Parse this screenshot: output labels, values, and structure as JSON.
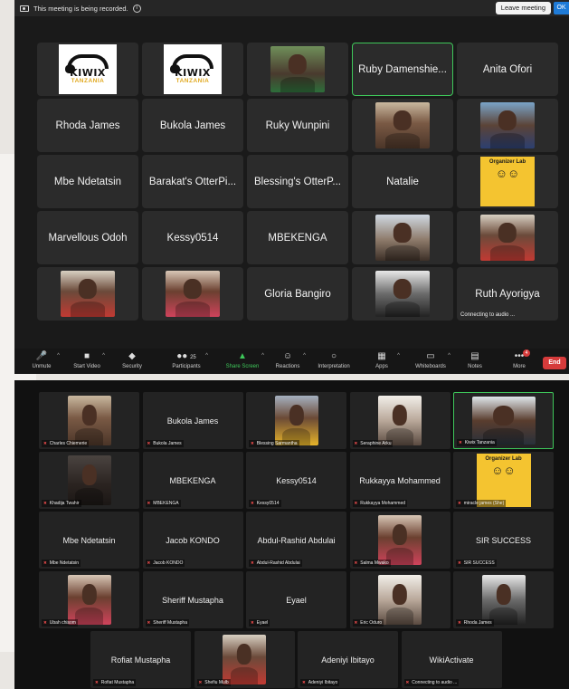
{
  "shot1": {
    "recording_notice": "This meeting is being recorded.",
    "leave_label": "Leave meeting",
    "ok_label": "OK",
    "tiles": [
      {
        "name": "",
        "kind": "kiwix"
      },
      {
        "name": "",
        "kind": "kiwix"
      },
      {
        "name": "",
        "kind": "photo",
        "tone": "ph-green"
      },
      {
        "name": "Ruby Damenshie...",
        "kind": "name",
        "active": true
      },
      {
        "name": "Anita Ofori",
        "kind": "name"
      },
      {
        "name": "Rhoda James",
        "kind": "name"
      },
      {
        "name": "Bukola James",
        "kind": "name"
      },
      {
        "name": "Ruky Wunpini",
        "kind": "name"
      },
      {
        "name": "",
        "kind": "photo",
        "tone": "ph-skin"
      },
      {
        "name": "",
        "kind": "photo",
        "tone": "ph-blue"
      },
      {
        "name": "Mbe Ndetatsin",
        "kind": "name"
      },
      {
        "name": "Barakat's OtterPi...",
        "kind": "name"
      },
      {
        "name": "Blessing's OtterP...",
        "kind": "name"
      },
      {
        "name": "Natalie",
        "kind": "name"
      },
      {
        "name": "",
        "kind": "orglab"
      },
      {
        "name": "Marvellous Odoh",
        "kind": "name"
      },
      {
        "name": "Kessy0514",
        "kind": "name"
      },
      {
        "name": "MBEKENGA",
        "kind": "name"
      },
      {
        "name": "",
        "kind": "photo",
        "tone": "ph-room"
      },
      {
        "name": "",
        "kind": "photo",
        "tone": "ph-red"
      },
      {
        "name": "",
        "kind": "photo",
        "tone": "ph-red"
      },
      {
        "name": "",
        "kind": "photo",
        "tone": "ph-pink"
      },
      {
        "name": "Gloria Bangiro",
        "kind": "name"
      },
      {
        "name": "",
        "kind": "photo",
        "tone": "ph-gray"
      },
      {
        "name": "Ruth Ayorigya",
        "kind": "name",
        "sub": "Connecting to audio ..."
      }
    ],
    "toolbar": {
      "unmute": "Unmute",
      "start_video": "Start Video",
      "security": "Security",
      "participants": "Participants",
      "participants_count": "25",
      "share_screen": "Share Screen",
      "reactions": "Reactions",
      "interpretation": "Interpretation",
      "apps": "Apps",
      "whiteboards": "Whiteboards",
      "notes": "Notes",
      "more": "More",
      "more_badge": "4",
      "end": "End"
    }
  },
  "shot2": {
    "tiles": [
      {
        "name": "",
        "label": "Charles Chiemerie",
        "kind": "photo",
        "tone": "ph-skin"
      },
      {
        "name": "Bukola James",
        "label": "Bukola James",
        "kind": "name"
      },
      {
        "name": "",
        "label": "Blessing Sarmantha",
        "kind": "photo",
        "tone": "ph-yellow"
      },
      {
        "name": "",
        "label": "Seraphine Arku",
        "kind": "photo",
        "tone": "ph-white"
      },
      {
        "name": "",
        "label": "Kiwix Tanzania",
        "kind": "photo",
        "tone": "ph-headset",
        "active": true
      },
      {
        "name": "",
        "label": "Khadija Twahir",
        "kind": "photo",
        "tone": "ph-dark"
      },
      {
        "name": "MBEKENGA",
        "label": "MBEKENGA",
        "kind": "name"
      },
      {
        "name": "Kessy0514",
        "label": "Kessy0514",
        "kind": "name"
      },
      {
        "name": "Rukkayya Mohammed",
        "label": "Rukkayya Mohammed",
        "kind": "name"
      },
      {
        "name": "",
        "label": "miracle james (She)",
        "kind": "orglab"
      },
      {
        "name": "Mbe Ndetatsin",
        "label": "Mbe Ndetatsin",
        "kind": "name"
      },
      {
        "name": "Jacob KONDO",
        "label": "Jacob KONDO",
        "kind": "name"
      },
      {
        "name": "Abdul-Rashid Abdulai",
        "label": "Abdul-Rashid Abdulai",
        "kind": "name"
      },
      {
        "name": "",
        "label": "Salma Mwako",
        "kind": "photo",
        "tone": "ph-pink"
      },
      {
        "name": "SIR SUCCESS",
        "label": "SIR SUCCESS",
        "kind": "name"
      },
      {
        "name": "",
        "label": "Ubah chisom",
        "kind": "photo",
        "tone": "ph-pink"
      },
      {
        "name": "Sheriff Mustapha",
        "label": "Sheriff Mustapha",
        "kind": "name"
      },
      {
        "name": "Eyael",
        "label": "Eyael",
        "kind": "name"
      },
      {
        "name": "",
        "label": "Eric Oduro",
        "kind": "photo",
        "tone": "ph-white"
      },
      {
        "name": "",
        "label": "Rhoda James",
        "kind": "photo",
        "tone": "ph-gray"
      },
      {
        "name": "Rofiat Mustapha",
        "label": "Rofiat Mustapha",
        "kind": "name"
      },
      {
        "name": "",
        "label": "Shefiu Mulb",
        "kind": "photo",
        "tone": "ph-red"
      },
      {
        "name": "Adeniyi Ibitayo",
        "label": "Adeniyi Ibitayo",
        "kind": "name"
      },
      {
        "name": "WikiActivate",
        "label": "Connecting to audio ...",
        "kind": "name"
      }
    ]
  },
  "logos": {
    "kiwix_word": "KIWIX",
    "kiwix_sub": "TANZANIA",
    "organizer_lab": "Organizer Lab"
  },
  "colors": {
    "active_speaker": "#3ec75a",
    "end_button": "#d63b3b",
    "share_screen": "#3ec75a"
  }
}
